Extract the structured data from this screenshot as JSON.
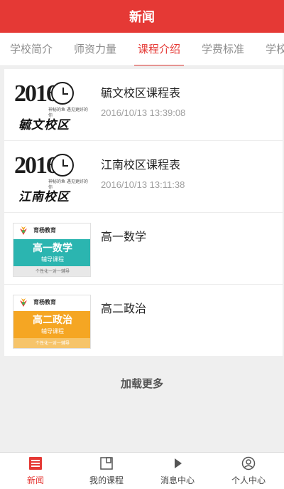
{
  "header": {
    "title": "新闻"
  },
  "tabs": [
    {
      "label": "学校简介"
    },
    {
      "label": "师资力量"
    },
    {
      "label": "课程介绍"
    },
    {
      "label": "学费标准"
    },
    {
      "label": "学校"
    }
  ],
  "active_tab_index": 2,
  "items": [
    {
      "title": "毓文校区课程表",
      "date": "2016/10/13 13:39:08",
      "thumb": {
        "year": "2016",
        "brush_text": "毓文校区",
        "small": "神秘的鱼\n遇见更好的你"
      }
    },
    {
      "title": "江南校区课程表",
      "date": "2016/10/13 13:11:38",
      "thumb": {
        "year": "2016",
        "brush_text": "江南校区",
        "small": "神秘的鱼\n遇见更好的你"
      }
    },
    {
      "title": "高一数学",
      "thumb": {
        "brand": "育杨教育",
        "subject": "高一数学",
        "sub": "辅导课程",
        "foot": "个性化一对一辅导"
      }
    },
    {
      "title": "高二政治",
      "thumb": {
        "brand": "育杨教育",
        "subject": "高二政治",
        "sub": "辅导课程",
        "foot": "个性化一对一辅导"
      }
    }
  ],
  "load_more": "加载更多",
  "bottom_nav": [
    {
      "label": "新闻",
      "icon": "news-icon",
      "active": true
    },
    {
      "label": "我的课程",
      "icon": "book-icon",
      "active": false
    },
    {
      "label": "消息中心",
      "icon": "play-icon",
      "active": false
    },
    {
      "label": "个人中心",
      "icon": "user-icon",
      "active": false
    }
  ],
  "colors": {
    "accent": "#e53935",
    "orange": "#f5a623",
    "teal": "#2bb5b0"
  }
}
